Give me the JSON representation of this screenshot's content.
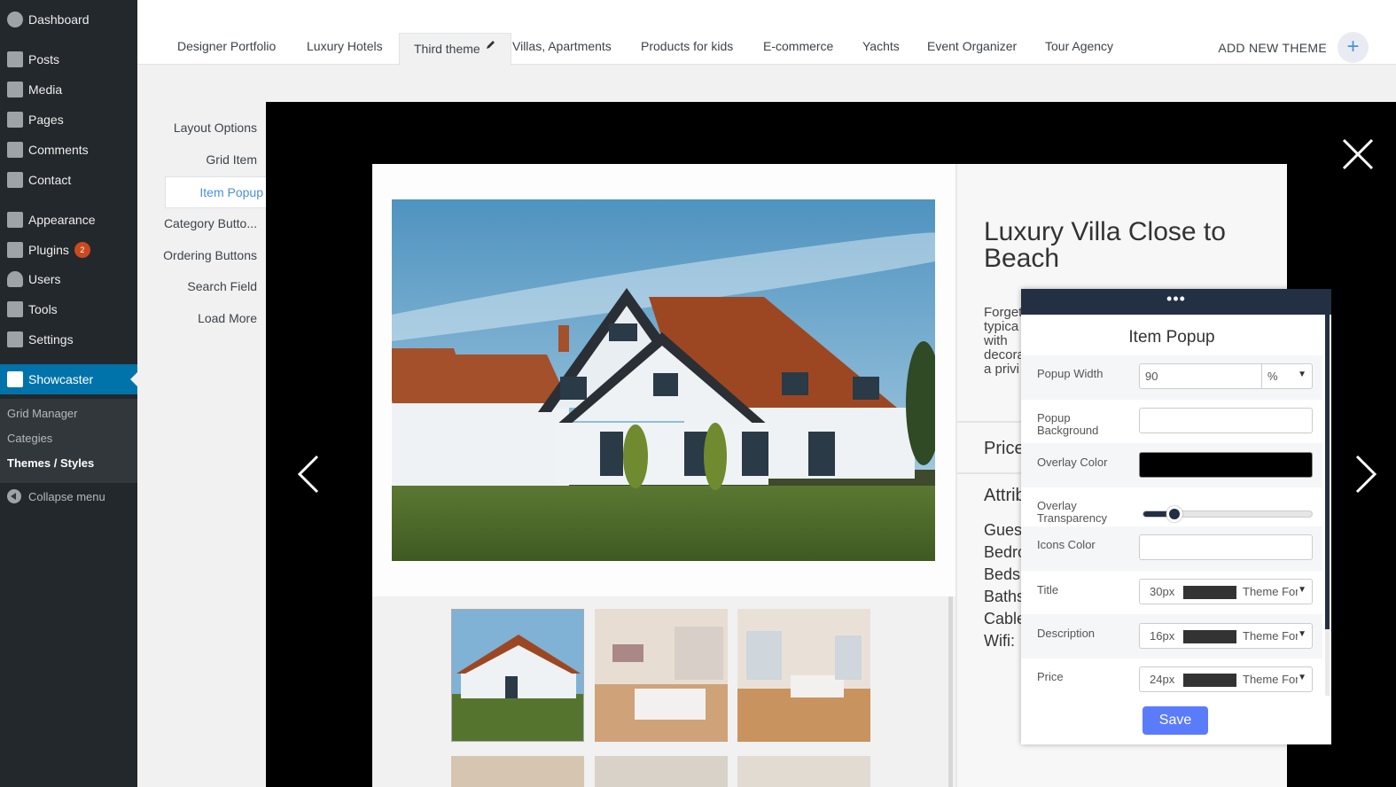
{
  "wp_menu": {
    "dashboard": "Dashboard",
    "posts": "Posts",
    "media": "Media",
    "pages": "Pages",
    "comments": "Comments",
    "contact": "Contact",
    "appearance": "Appearance",
    "plugins": "Plugins",
    "plugins_badge": "2",
    "users": "Users",
    "tools": "Tools",
    "settings": "Settings",
    "showcaster": "Showcaster",
    "sub": {
      "grid_manager": "Grid Manager",
      "categories": "Categies",
      "themes_styles": "Themes / Styles"
    },
    "collapse": "Collapse menu"
  },
  "tabs": {
    "items": [
      "Designer Portfolio",
      "Luxury Hotels",
      "Third theme",
      "Villas, Apartments",
      "Products for kids",
      "E-commerce",
      "Yachts",
      "Event Organizer",
      "Tour Agency"
    ],
    "active_index": 2,
    "add_new": "ADD NEW THEME"
  },
  "settings_menu": {
    "layout_options": "Layout Options",
    "grid_item": "Grid Item",
    "item_popup": "Item Popup",
    "category_buttons": "Category Butto...",
    "ordering_buttons": "Ordering Buttons",
    "search_field": "Search Field",
    "load_more": "Load More"
  },
  "preview": {
    "title": "Luxury Villa Close to Beach",
    "description_lines": [
      "Forget",
      "typica",
      "with",
      "decora",
      "a privi"
    ],
    "price_label": "Price",
    "attributes_heading": "Attrib",
    "attributes": [
      "Guest",
      "Bedro",
      "Beds:",
      "Baths",
      "Cable",
      "Wifi:"
    ]
  },
  "style_panel": {
    "handle": "•••",
    "title": "Item Popup",
    "popup_width_label": "Popup Width",
    "popup_width_value": "90",
    "popup_width_unit": "%",
    "popup_background_label": "Popup Background",
    "overlay_color_label": "Overlay Color",
    "overlay_color": "#000000",
    "overlay_transparency_label": "Overlay Transparency",
    "overlay_transparency": 0.15,
    "icons_color_label": "Icons Color",
    "title_label": "Title",
    "title_size": "30",
    "description_label": "Description",
    "description_size": "16",
    "price_label": "Price",
    "price_size": "24",
    "px_unit": "px",
    "font_name": "Theme Font",
    "save": "Save"
  },
  "colors": {
    "wp_sidebar": "#23282d",
    "wp_accent": "#0073aa",
    "panel_header": "#232f43",
    "save_button": "#5b7cfa",
    "link_blue": "#4a90d9"
  }
}
